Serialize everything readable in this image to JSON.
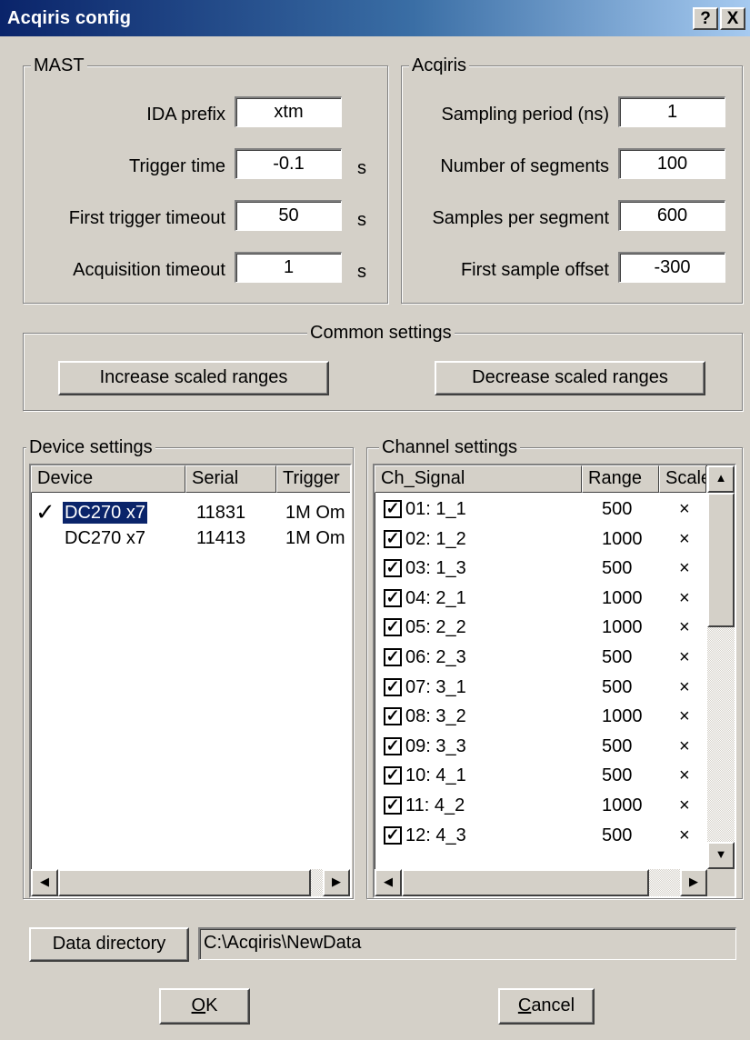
{
  "window": {
    "title": "Acqiris config",
    "help_btn": "?",
    "close_btn": "X"
  },
  "mast": {
    "title": "MAST",
    "fields": [
      {
        "label": "IDA prefix",
        "value": "xtm",
        "unit": ""
      },
      {
        "label": "Trigger time",
        "value": "-0.1",
        "unit": "s"
      },
      {
        "label": "First trigger timeout",
        "value": "50",
        "unit": "s"
      },
      {
        "label": "Acquisition timeout",
        "value": "1",
        "unit": "s"
      }
    ]
  },
  "acqiris": {
    "title": "Acqiris",
    "fields": [
      {
        "label": "Sampling period (ns)",
        "value": "1"
      },
      {
        "label": "Number of segments",
        "value": "100"
      },
      {
        "label": "Samples per segment",
        "value": "600"
      },
      {
        "label": "First sample offset",
        "value": "-300"
      }
    ]
  },
  "common": {
    "title": "Common settings",
    "increase_btn": "Increase scaled ranges",
    "decrease_btn": "Decrease scaled ranges"
  },
  "device": {
    "title": "Device settings",
    "headers": [
      "Device",
      "Serial",
      "Trigger"
    ],
    "rows": [
      {
        "checked": "✓",
        "device": "DC270 x7",
        "serial": "11831",
        "trigger": "1M Om"
      },
      {
        "checked": "",
        "device": "DC270 x7",
        "serial": "11413",
        "trigger": "1M Om"
      }
    ]
  },
  "channel": {
    "title": "Channel settings",
    "headers": [
      "Ch_Signal",
      "Range",
      "Scale"
    ],
    "rows": [
      {
        "check": "✓",
        "signal": "01: 1_1",
        "range": "500",
        "scale": "×"
      },
      {
        "check": "✓",
        "signal": "02: 1_2",
        "range": "1000",
        "scale": "×"
      },
      {
        "check": "✓",
        "signal": "03: 1_3",
        "range": "500",
        "scale": "×"
      },
      {
        "check": "✓",
        "signal": "04: 2_1",
        "range": "1000",
        "scale": "×"
      },
      {
        "check": "✓",
        "signal": "05: 2_2",
        "range": "1000",
        "scale": "×"
      },
      {
        "check": "✓",
        "signal": "06: 2_3",
        "range": "500",
        "scale": "×"
      },
      {
        "check": "✓",
        "signal": "07: 3_1",
        "range": "500",
        "scale": "×"
      },
      {
        "check": "✓",
        "signal": "08: 3_2",
        "range": "1000",
        "scale": "×"
      },
      {
        "check": "✓",
        "signal": "09: 3_3",
        "range": "500",
        "scale": "×"
      },
      {
        "check": "✓",
        "signal": "10: 4_1",
        "range": "500",
        "scale": "×"
      },
      {
        "check": "✓",
        "signal": "11: 4_2",
        "range": "1000",
        "scale": "×"
      },
      {
        "check": "✓",
        "signal": "12: 4_3",
        "range": "500",
        "scale": "×"
      }
    ]
  },
  "footer": {
    "data_dir_btn": "Data directory",
    "data_dir_value": "C:\\Acqiris\\NewData",
    "ok_rest": "K",
    "ok_accel": "O",
    "cancel_rest": "ancel",
    "cancel_accel": "C"
  },
  "icons": {
    "up": "▲",
    "down": "▼",
    "left": "◀",
    "right": "▶"
  }
}
